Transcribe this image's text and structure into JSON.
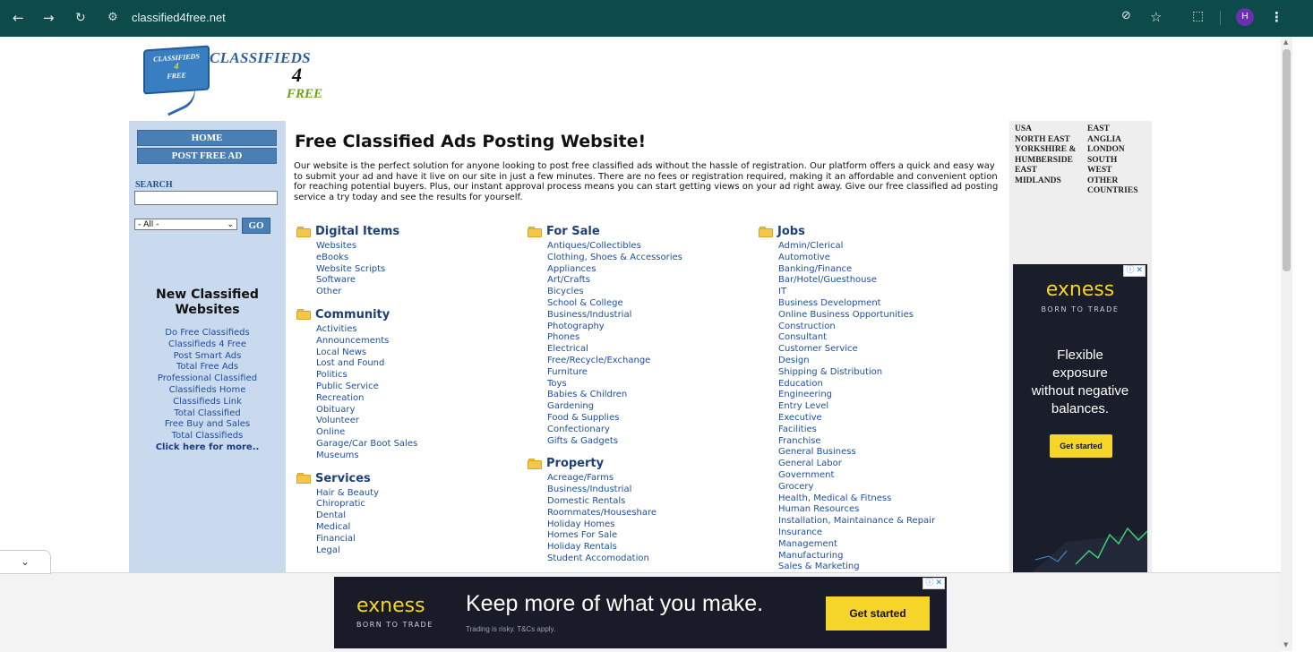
{
  "browser": {
    "back_icon": "back-arrow-icon",
    "forward_icon": "forward-arrow-icon",
    "reload_icon": "reload-icon",
    "url": "classified4free.net",
    "profile_initial": "H"
  },
  "logo": {
    "box_line1": "CLASSIFIEDS",
    "box_line2": "4",
    "box_line3": "FREE",
    "word1": "CLASSIFIEDS",
    "word2": "4",
    "word3": "FREE"
  },
  "leftbar": {
    "home": "HOME",
    "post_free_ad": "POST FREE AD",
    "search_label": "SEARCH",
    "search_value": "",
    "select_value": "- All -",
    "go": "GO",
    "new_heading_line1": "New Classified",
    "new_heading_line2": "Websites",
    "new_sites": [
      "Do Free Classifieds",
      "Classifieds 4 Free",
      "Post Smart Ads",
      "Total Free Ads",
      "Professional Classified",
      "Classifieds Home",
      "Classifieds Link",
      "Total Classified",
      "Free Buy and Sales",
      "Total Classifieds"
    ],
    "more": "Click here for more.."
  },
  "main": {
    "title": "Free Classified Ads Posting Website!",
    "intro": "Our website is the perfect solution for anyone looking to post free classified ads without the hassle of registration. Our platform offers a quick and easy way to submit your ad and have it live on our site in just a few minutes. There are no fees or registration required, making it an affordable and convenient option for reaching potential buyers. Plus, our instant approval process means you can start getting views on your ad right away. Give our free classified ad posting service a try today and see the results for yourself.",
    "columns": [
      [
        {
          "heading": "Digital Items",
          "links": [
            "Websites",
            "eBooks",
            "Website Scripts",
            "Software",
            "Other"
          ]
        },
        {
          "heading": "Community",
          "links": [
            "Activities",
            "Announcements",
            "Local News",
            "Lost and Found",
            "Politics",
            "Public Service",
            "Recreation",
            "Obituary",
            "Volunteer",
            "Online",
            "Garage/Car Boot Sales",
            "Museums"
          ]
        },
        {
          "heading": "Services",
          "links": [
            "Hair & Beauty",
            "Chiropratic",
            "Dental",
            "Medical",
            "Financial",
            "Legal"
          ]
        }
      ],
      [
        {
          "heading": "For Sale",
          "links": [
            "Antiques/Collectibles",
            "Clothing, Shoes & Accessories",
            "Appliances",
            "Art/Crafts",
            "Bicycles",
            "School & College",
            "Business/Industrial",
            "Photography",
            "Phones",
            "Electrical",
            "Free/Recycle/Exchange",
            "Furniture",
            "Toys",
            "Babies & Children",
            "Gardening",
            "Food & Supplies",
            "Confectionary",
            "Gifts & Gadgets"
          ]
        },
        {
          "heading": "Property",
          "links": [
            "Acreage/Farms",
            "Business/Industrial",
            "Domestic Rentals",
            "Roommates/Houseshare",
            "Holiday Homes",
            "Homes For Sale",
            "Holiday Rentals",
            "Student Accomodation"
          ]
        }
      ],
      [
        {
          "heading": "Jobs",
          "links": [
            "Admin/Clerical",
            "Automotive",
            "Banking/Finance",
            "Bar/Hotel/Guesthouse",
            "IT",
            "Business Development",
            "Online Business Opportunities",
            "Construction",
            "Consultant",
            "Customer Service",
            "Design",
            "Shipping & Distribution",
            "Education",
            "Engineering",
            "Entry Level",
            "Executive",
            "Facilities",
            "Franchise",
            "General Business",
            "General Labor",
            "Government",
            "Grocery",
            "Health, Medical & Fitness",
            "Human Resources",
            "Installation, Maintainance & Repair",
            "Insurance",
            "Management",
            "Manufacturing",
            "Sales & Marketing"
          ]
        }
      ]
    ]
  },
  "regions": {
    "col1": [
      "USA",
      "NORTH EAST",
      "YORKSHIRE &",
      "HUMBERSIDE",
      "EAST",
      "MIDLANDS"
    ],
    "col2": [
      "EAST",
      "ANGLIA",
      "LONDON",
      "SOUTH",
      "WEST",
      "OTHER",
      "COUNTRIES"
    ]
  },
  "ad_right": {
    "brand": "exness",
    "tagline": "BORN TO TRADE",
    "copy_lines": [
      "Flexible",
      "exposure",
      "without negative",
      "balances."
    ],
    "cta": "Get started"
  },
  "ad_bottom": {
    "brand": "exness",
    "tagline": "BORN TO TRADE",
    "headline": "Keep more of what you make.",
    "fine_print": "Trading is risky. T&Cs apply.",
    "cta": "Get started"
  },
  "colors": {
    "chrome": "#0d4a4a",
    "sidebar": "#c9d9ee",
    "nav_button": "#4a7fb5",
    "link": "#1d4fa0",
    "ad_bg": "#191c28",
    "ad_accent": "#f5d52a"
  }
}
